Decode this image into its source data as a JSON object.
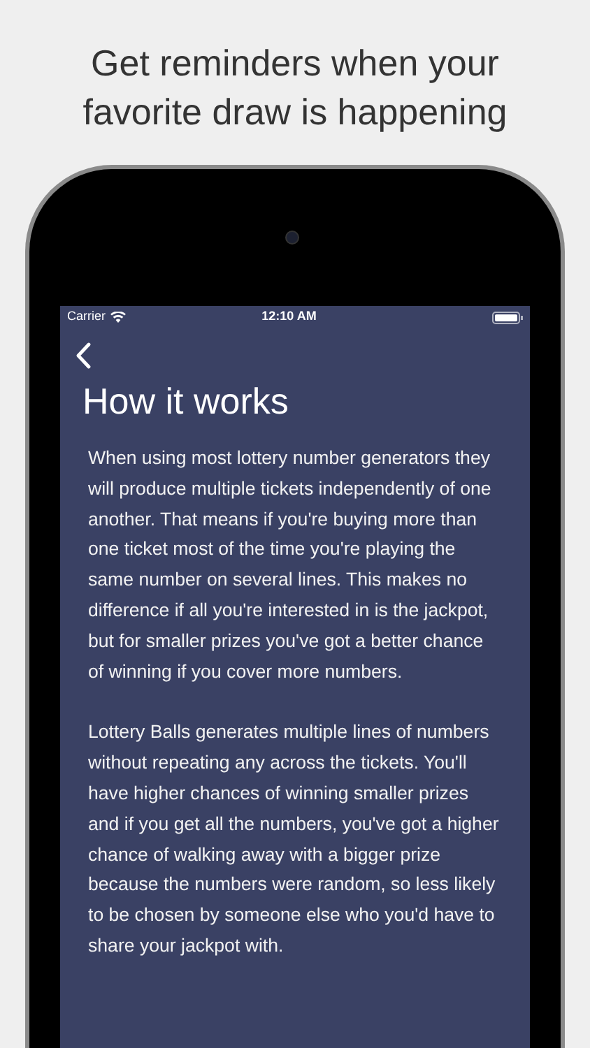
{
  "headline": "Get reminders when your favorite draw is happening",
  "status_bar": {
    "carrier": "Carrier",
    "time": "12:10 AM"
  },
  "title": "How it works",
  "paragraphs": [
    "When using most lottery number generators they will produce multiple tickets independently of one another. That means if you're buying more than one ticket most of the time you're playing the same number on several lines. This makes no difference if all you're interested in is the jackpot, but for smaller prizes you've got a better chance of winning if you cover more numbers.",
    "Lottery Balls generates multiple lines of numbers without repeating any across the tickets. You'll have higher chances of winning smaller prizes and if you get all the numbers, you've got a higher chance of walking away with a bigger prize because the numbers were random, so less likely to be chosen by someone else who you'd have to share your jackpot with."
  ]
}
